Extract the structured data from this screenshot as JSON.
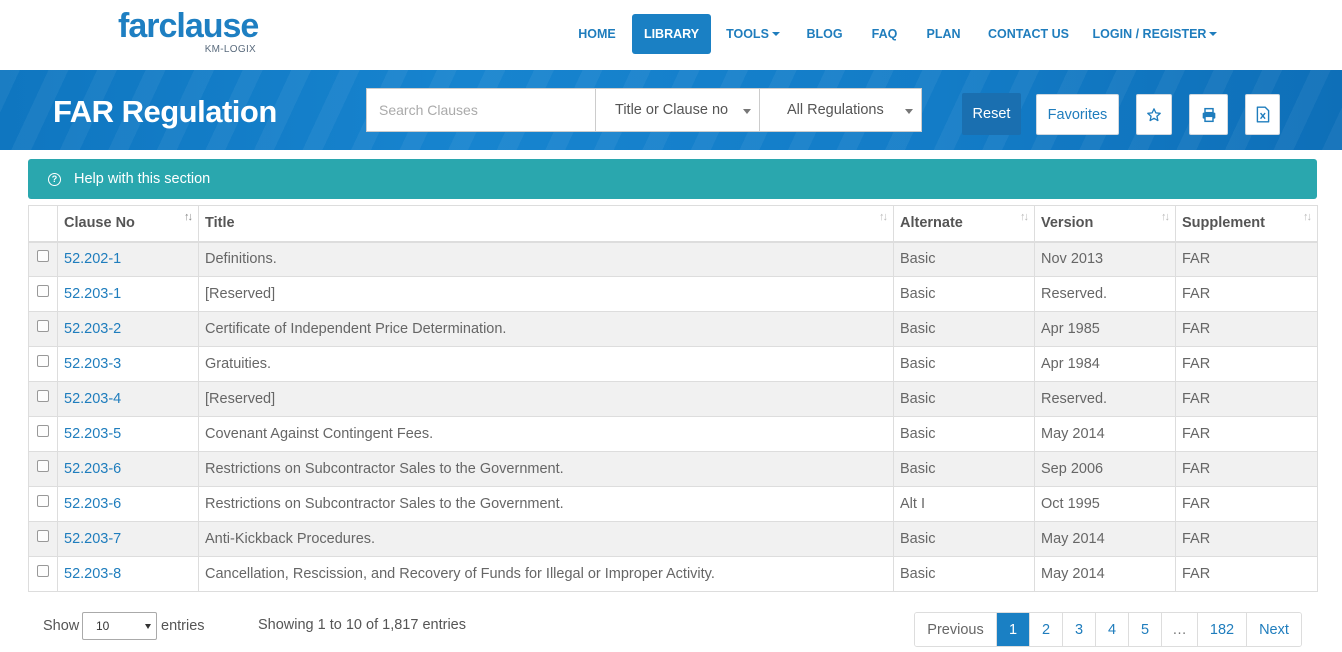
{
  "brand": {
    "name": "farclause",
    "tagline": "KM-LOGIX"
  },
  "nav": [
    {
      "label": "HOME",
      "active": false,
      "dropdown": false
    },
    {
      "label": "LIBRARY",
      "active": true,
      "dropdown": false
    },
    {
      "label": "TOOLS",
      "active": false,
      "dropdown": true
    },
    {
      "label": "BLOG",
      "active": false,
      "dropdown": false
    },
    {
      "label": "FAQ",
      "active": false,
      "dropdown": false
    },
    {
      "label": "PLAN",
      "active": false,
      "dropdown": false
    },
    {
      "label": "CONTACT US",
      "active": false,
      "dropdown": false
    },
    {
      "label": "LOGIN / REGISTER",
      "active": false,
      "dropdown": true
    }
  ],
  "banner": {
    "title": "FAR Regulation",
    "search_placeholder": "Search Clauses",
    "search_value": "",
    "filter_field": "Title or Clause no",
    "filter_regulation": "All Regulations",
    "reset_label": "Reset",
    "favorites_label": "Favorites",
    "icons": [
      "star-icon",
      "print-icon",
      "excel-export-icon"
    ]
  },
  "help": {
    "label": "Help with this section",
    "icon": "question-circle-icon"
  },
  "table": {
    "columns": [
      "",
      "Clause No",
      "Title",
      "Alternate",
      "Version",
      "Supplement"
    ],
    "rows": [
      {
        "clause": "52.202-1",
        "title": "Definitions.",
        "alternate": "Basic",
        "version": "Nov 2013",
        "supplement": "FAR"
      },
      {
        "clause": "52.203-1",
        "title": "[Reserved]",
        "alternate": "Basic",
        "version": "Reserved.",
        "supplement": "FAR"
      },
      {
        "clause": "52.203-2",
        "title": "Certificate of Independent Price Determination.",
        "alternate": "Basic",
        "version": "Apr 1985",
        "supplement": "FAR"
      },
      {
        "clause": "52.203-3",
        "title": "Gratuities.",
        "alternate": "Basic",
        "version": "Apr 1984",
        "supplement": "FAR"
      },
      {
        "clause": "52.203-4",
        "title": "[Reserved]",
        "alternate": "Basic",
        "version": "Reserved.",
        "supplement": "FAR"
      },
      {
        "clause": "52.203-5",
        "title": "Covenant Against Contingent Fees.",
        "alternate": "Basic",
        "version": "May 2014",
        "supplement": "FAR"
      },
      {
        "clause": "52.203-6",
        "title": "Restrictions on Subcontractor Sales to the Government.",
        "alternate": "Basic",
        "version": "Sep 2006",
        "supplement": "FAR"
      },
      {
        "clause": "52.203-6",
        "title": "Restrictions on Subcontractor Sales to the Government.",
        "alternate": "Alt I",
        "version": "Oct 1995",
        "supplement": "FAR"
      },
      {
        "clause": "52.203-7",
        "title": "Anti-Kickback Procedures.",
        "alternate": "Basic",
        "version": "May 2014",
        "supplement": "FAR"
      },
      {
        "clause": "52.203-8",
        "title": "Cancellation, Rescission, and Recovery of Funds for Illegal or Improper Activity.",
        "alternate": "Basic",
        "version": "May 2014",
        "supplement": "FAR"
      }
    ]
  },
  "footer": {
    "show_label": "Show",
    "page_length": "10",
    "entries_label": "entries",
    "info": "Showing 1 to 10 of 1,817 entries",
    "pagination": [
      "Previous",
      "1",
      "2",
      "3",
      "4",
      "5",
      "…",
      "182",
      "Next"
    ],
    "current_page": "1"
  },
  "colors": {
    "brand_blue": "#1a80c4",
    "help_teal": "#2aa7ae",
    "link_blue": "#1f7dbd"
  }
}
